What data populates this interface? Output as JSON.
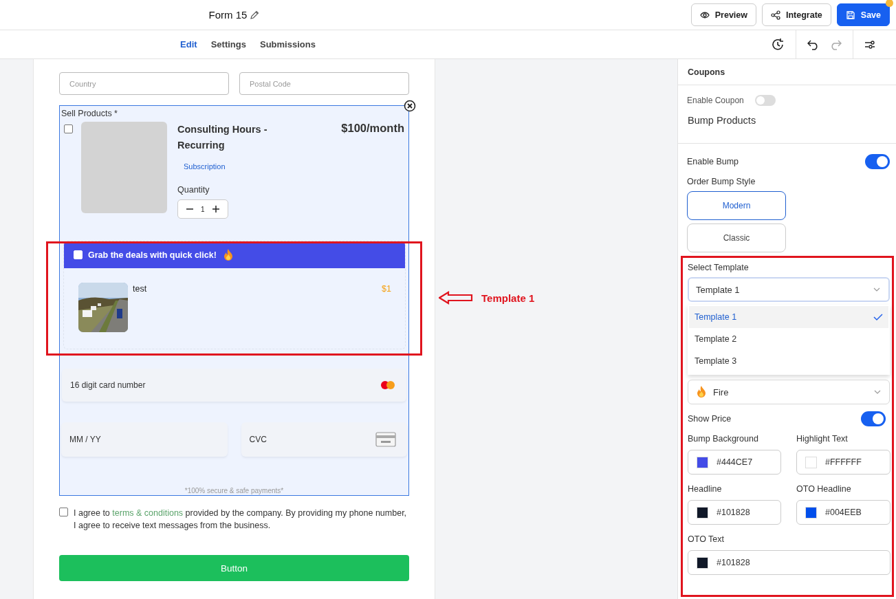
{
  "header": {
    "title": "Form 15",
    "buttons": [
      {
        "label": "Preview",
        "kind": "preview"
      },
      {
        "label": "Integrate",
        "kind": "integrate"
      },
      {
        "label": "Save",
        "kind": "save",
        "unsaved": true
      }
    ]
  },
  "tabs": [
    {
      "label": "Edit",
      "selected": true
    },
    {
      "label": "Settings",
      "selected": false
    },
    {
      "label": "Submissions",
      "selected": false
    }
  ],
  "form": {
    "fields": [
      {
        "placeholder": "Country"
      },
      {
        "placeholder": "Postal Code"
      }
    ],
    "products": {
      "label": "Sell Products",
      "required_mark": "*",
      "item": {
        "checked": false,
        "name": "Consulting Hours - Recurring",
        "price": "$100/month",
        "badge": "Subscription",
        "quantity_label": "Quantity",
        "quantity": "1"
      }
    },
    "bump": {
      "checked": false,
      "headline": "Grab the deals with quick click!",
      "name": "test",
      "price": "$1"
    },
    "card": {
      "number_placeholder": "16 digit card number",
      "expiry_placeholder": "MM / YY",
      "cvc_placeholder": "CVC",
      "note": "*100% secure & safe payments*"
    },
    "consent": {
      "checked": false,
      "before": "I agree to ",
      "link": "terms & conditions",
      "after": " provided by the company. By providing my phone number, I agree to receive text messages from the business."
    },
    "submit": "Button"
  },
  "annotation": {
    "label": "Template 1"
  },
  "panel": {
    "coupons": {
      "title": "Coupons",
      "enable_label": "Enable Coupon",
      "enabled": false
    },
    "bump": {
      "title": "Bump Products",
      "enable_label": "Enable Bump",
      "enabled": true,
      "style_label": "Order Bump Style",
      "styles": [
        {
          "label": "Modern",
          "selected": true
        },
        {
          "label": "Classic",
          "selected": false
        }
      ],
      "template_label": "Select Template",
      "template_value": "Template 1",
      "template_options": [
        {
          "label": "Template 1",
          "selected": true
        },
        {
          "label": "Template 2",
          "selected": false
        },
        {
          "label": "Template 3",
          "selected": false
        }
      ],
      "icon_value": "Fire",
      "show_price_label": "Show Price",
      "show_price": true,
      "colors": [
        {
          "label": "Bump Background",
          "value": "#444CE7",
          "color": "#444ce7"
        },
        {
          "label": "Highlight Text",
          "value": "#FFFFFF",
          "color": "#ffffff"
        },
        {
          "label": "Headline",
          "value": "#101828",
          "color": "#101828"
        },
        {
          "label": "OTO Headline",
          "value": "#004EEB",
          "color": "#004eeb"
        },
        {
          "label": "OTO Text",
          "value": "#101828",
          "color": "#101828"
        }
      ]
    }
  }
}
